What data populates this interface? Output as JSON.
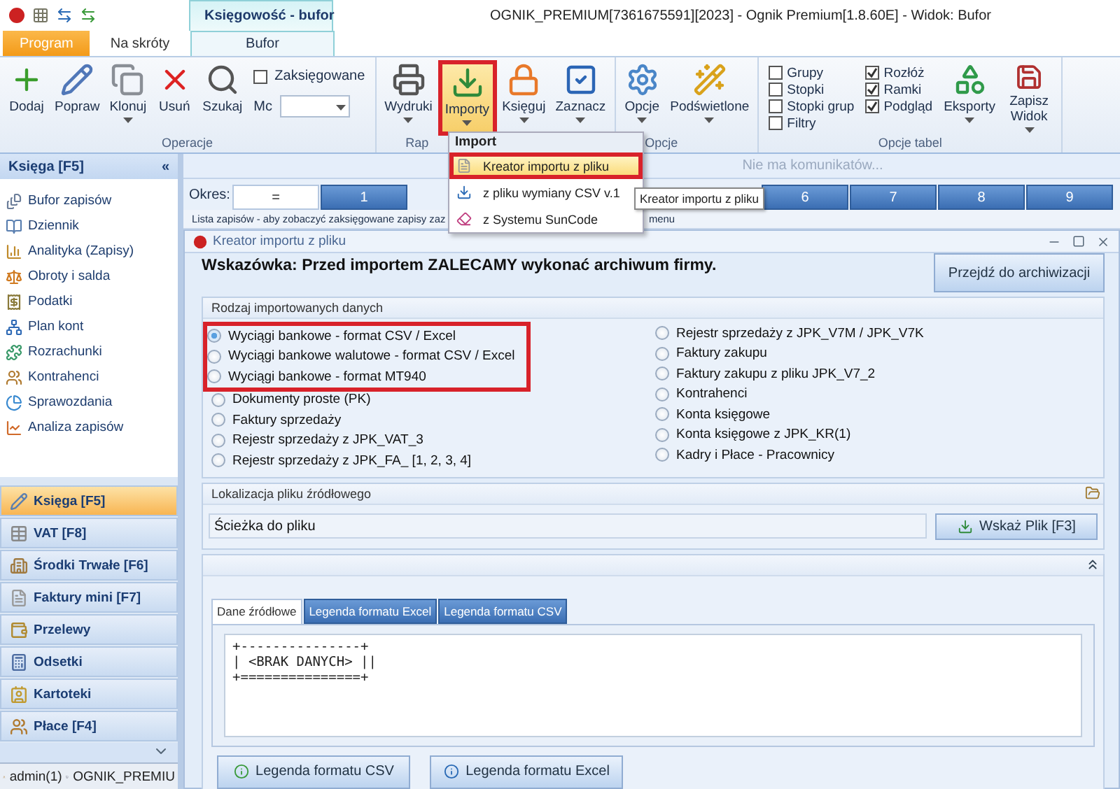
{
  "title_bar": {
    "context_tab": "Księgowość - bufor",
    "title": "OGNIK_PREMIUM[7361675591][2023] - Ognik Premium[1.8.60E] - Widok: Bufor"
  },
  "ribbon_tabs": [
    {
      "label": "Program",
      "kind": "app",
      "selected": false
    },
    {
      "label": "Na skróty",
      "kind": "tab",
      "selected": false
    },
    {
      "label": "Bufor",
      "kind": "tab",
      "selected": true
    }
  ],
  "ribbon_groups": [
    {
      "label": "Operacje",
      "items": [
        {
          "kind": "button",
          "label": "Dodaj",
          "dropdown": false,
          "highlighted": false
        },
        {
          "kind": "button",
          "label": "Popraw",
          "dropdown": false,
          "highlighted": false
        },
        {
          "kind": "button",
          "label": "Klonuj",
          "dropdown": true,
          "highlighted": false
        },
        {
          "kind": "button",
          "label": "Usuń",
          "dropdown": false,
          "highlighted": false
        },
        {
          "kind": "button",
          "label": "Szukaj",
          "dropdown": false,
          "highlighted": false
        },
        {
          "kind": "fields",
          "checkbox": {
            "label": "Zaksięgowane",
            "checked": false
          },
          "select_label": "Mc"
        }
      ]
    },
    {
      "label": "Rap",
      "items": [
        {
          "kind": "button",
          "label": "Wydruki",
          "dropdown": true,
          "highlighted": false
        },
        {
          "kind": "button",
          "label": "Importy",
          "dropdown": true,
          "highlighted": true
        },
        {
          "kind": "button",
          "label": "Księguj",
          "dropdown": true,
          "highlighted": false
        },
        {
          "kind": "button",
          "label": "Zaznacz",
          "dropdown": true,
          "highlighted": false
        }
      ]
    },
    {
      "label": "Opcje",
      "items": [
        {
          "kind": "button",
          "label": "Opcje",
          "dropdown": true,
          "highlighted": false
        },
        {
          "kind": "button",
          "label": "Podświetlone",
          "dropdown": true,
          "highlighted": false
        }
      ]
    },
    {
      "label": "Opcje tabel",
      "items": [
        {
          "kind": "checks",
          "checks": [
            {
              "label": "Grupy",
              "checked": false
            },
            {
              "label": "Stopki",
              "checked": false
            },
            {
              "label": "Stopki grup",
              "checked": false
            },
            {
              "label": "Filtry",
              "checked": false
            },
            {
              "label": "Rozłóż",
              "checked": true
            },
            {
              "label": "Ramki",
              "checked": true
            },
            {
              "label": "Podgląd",
              "checked": true
            }
          ]
        },
        {
          "kind": "button",
          "label": "Eksporty",
          "dropdown": true,
          "highlighted": false
        },
        {
          "kind": "button",
          "label": "Zapisz Widok",
          "dropdown": true,
          "highlighted": false
        }
      ]
    }
  ],
  "sidebar": {
    "header": "Księga [F5]",
    "collapse": "«",
    "items": [
      {
        "label": "Bufor zapisów"
      },
      {
        "label": "Dziennik"
      },
      {
        "label": "Analityka (Zapisy)"
      },
      {
        "label": "Obroty i salda"
      },
      {
        "label": "Podatki"
      },
      {
        "label": "Plan kont"
      },
      {
        "label": "Rozrachunki"
      },
      {
        "label": "Kontrahenci"
      },
      {
        "label": "Sprawozdania"
      },
      {
        "label": "Analiza zapisów"
      }
    ],
    "nav": [
      {
        "label": "Księga [F5]",
        "selected": true
      },
      {
        "label": "VAT [F8]",
        "selected": false
      },
      {
        "label": "Środki Trwałe [F6]",
        "selected": false
      },
      {
        "label": "Faktury mini [F7]",
        "selected": false
      },
      {
        "label": "Przelewy",
        "selected": false
      },
      {
        "label": "Odsetki",
        "selected": false
      },
      {
        "label": "Kartoteki",
        "selected": false
      },
      {
        "label": "Płace [F4]",
        "selected": false
      }
    ]
  },
  "status_bar": [
    "admin(1)",
    "OGNIK_PREMIU"
  ],
  "messages": "Nie ma komunikatów...",
  "period": {
    "label": "Okres:",
    "tabs": [
      {
        "label": "=",
        "selected": true
      },
      {
        "label": "1",
        "selected": false
      },
      {
        "label": "6",
        "selected": false
      },
      {
        "label": "7",
        "selected": false
      },
      {
        "label": "8",
        "selected": false
      },
      {
        "label": "9",
        "selected": false
      }
    ]
  },
  "hint_line": [
    "Lista zapisów - aby zobaczyć zaksięgowane zapisy zaz",
    "menu"
  ],
  "import_window": {
    "title": "Kreator importu z pliku",
    "hint": "Wskazówka: Przed importem ZALECAMY wykonać archiwum firmy.",
    "archive_button": "Przejdź do archiwizacji",
    "types_title": "Rodzaj importowanych danych",
    "type_columns": [
      [
        {
          "label": "Wyciągi bankowe - format CSV / Excel",
          "selected": true,
          "highlighted": true
        },
        {
          "label": "Wyciągi bankowe walutowe - format CSV / Excel",
          "selected": false,
          "highlighted": true
        },
        {
          "label": "Wyciągi bankowe - format MT940",
          "selected": false,
          "highlighted": true
        },
        {
          "label": "Dokumenty proste (PK)",
          "selected": false,
          "highlighted": false
        },
        {
          "label": "Faktury sprzedaży",
          "selected": false,
          "highlighted": false
        },
        {
          "label": "Rejestr sprzedaży z JPK_VAT_3",
          "selected": false,
          "highlighted": false
        },
        {
          "label": "Rejestr sprzedaży z JPK_FA_ [1, 2, 3, 4]",
          "selected": false,
          "highlighted": false
        }
      ],
      [
        {
          "label": "Rejestr sprzedaży z JPK_V7M / JPK_V7K",
          "selected": false,
          "highlighted": false
        },
        {
          "label": "Faktury zakupu",
          "selected": false,
          "highlighted": false
        },
        {
          "label": "Faktury zakupu z pliku JPK_V7_2",
          "selected": false,
          "highlighted": false
        },
        {
          "label": "Kontrahenci",
          "selected": false,
          "highlighted": false
        },
        {
          "label": "Konta księgowe",
          "selected": false,
          "highlighted": false
        },
        {
          "label": "Konta księgowe z JPK_KR(1)",
          "selected": false,
          "highlighted": false
        },
        {
          "label": "Kadry i Płace - Pracownicy",
          "selected": false,
          "highlighted": false
        }
      ]
    ],
    "source_title": "Lokalizacja pliku źródłowego",
    "path_value": "Ścieżka do pliku",
    "browse_button": "Wskaż Plik [F3]",
    "preview_tabs": [
      {
        "label": "Dane źródłowe",
        "selected": true
      },
      {
        "label": "Legenda formatu Excel",
        "selected": false
      },
      {
        "label": "Legenda formatu CSV",
        "selected": false
      }
    ],
    "preview_text": "+---------------+\n| <BRAK DANYCH> ||\n+===============+",
    "legend_buttons": [
      "Legenda formatu CSV",
      "Legenda formatu Excel"
    ]
  },
  "dropdown_menu": {
    "header": "Import",
    "items": [
      {
        "label": "Kreator importu z pliku",
        "highlighted": true
      },
      {
        "label": "z pliku wymiany CSV v.1",
        "highlighted": false
      },
      {
        "label": "z Systemu SunCode",
        "highlighted": false
      }
    ]
  },
  "tooltip": "Kreator importu z pliku"
}
